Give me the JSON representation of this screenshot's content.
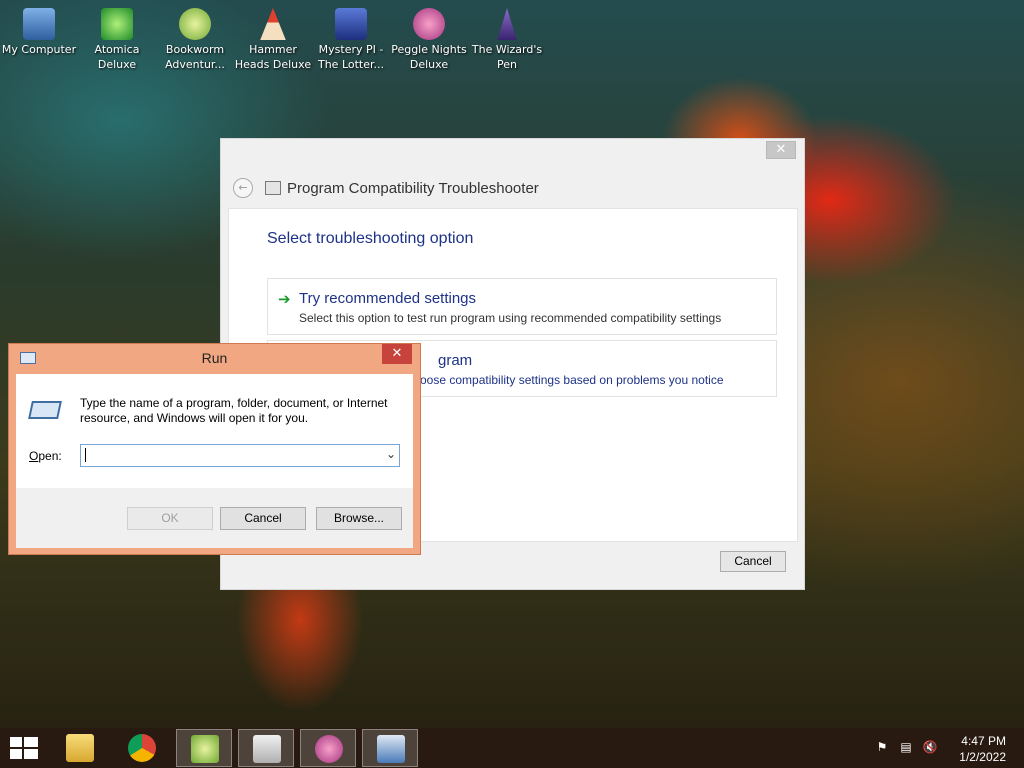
{
  "desktop": {
    "icons": [
      {
        "label": "My Computer",
        "icon": "computer-icon",
        "color": "#4a7fc7"
      },
      {
        "label": "Atomica Deluxe",
        "icon": "atomica-icon",
        "color": "#2fa83a"
      },
      {
        "label": "Bookworm Adventur...",
        "icon": "bookworm-icon",
        "color": "#8ac24a"
      },
      {
        "label": "Hammer Heads Deluxe",
        "icon": "gnome-icon",
        "color": "#d6402e"
      },
      {
        "label": "Mystery PI - The Lotter...",
        "icon": "mystery-pi-icon",
        "color": "#3248a8"
      },
      {
        "label": "Peggle Nights Deluxe",
        "icon": "peggle-icon",
        "color": "#c44fa0"
      },
      {
        "label": "The Wizard's Pen",
        "icon": "wizard-icon",
        "color": "#5a3c8e"
      }
    ]
  },
  "troubleshooter": {
    "title": "Program Compatibility Troubleshooter",
    "close_glyph": "✕",
    "back_glyph": "←",
    "heading": "Select troubleshooting option",
    "options": [
      {
        "title": "Try recommended settings",
        "description": "Select this option to test run program using recommended compatibility settings"
      },
      {
        "title": "gram",
        "description": "oose compatibility settings based on problems you notice"
      }
    ],
    "cancel_label": "Cancel"
  },
  "run_dialog": {
    "title": "Run",
    "close_glyph": "✕",
    "description": "Type the name of a program, folder, document, or Internet resource, and Windows will open it for you.",
    "open_label_prefix": "",
    "open_label_access": "O",
    "open_label_rest": "pen:",
    "open_value": "",
    "ok_label": "OK",
    "cancel_label": "Cancel",
    "browse_label": "Browse..."
  },
  "taskbar": {
    "items": [
      {
        "icon": "file-explorer-icon",
        "active": false
      },
      {
        "icon": "chrome-icon",
        "active": false
      },
      {
        "icon": "bookworm-icon",
        "active": true
      },
      {
        "icon": "troubleshooter-icon",
        "active": true
      },
      {
        "icon": "peggle-icon",
        "active": true
      },
      {
        "icon": "run-icon",
        "active": true
      }
    ],
    "tray": [
      "action-center-icon",
      "network-icon",
      "volume-muted-icon"
    ],
    "time": "4:47 PM",
    "date": "1/2/2022"
  },
  "colors": {
    "accent_title": "#1e3287",
    "run_frame": "#f2a783",
    "close_red": "#c7443d"
  }
}
